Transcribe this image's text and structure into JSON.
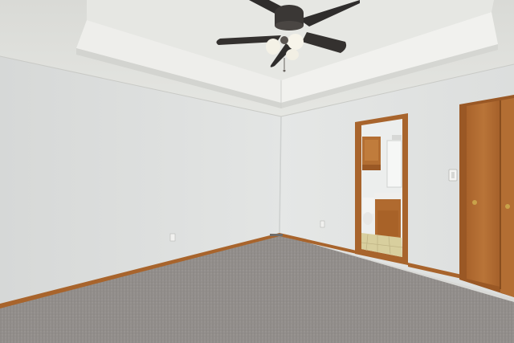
{
  "scene": {
    "description_items": [
      "ceiling-fan",
      "tray-ceiling",
      "bathroom-doorway",
      "closet-door",
      "carpet-floor",
      "wall-outlet",
      "light-switch"
    ]
  },
  "colors": {
    "ceiling": "#e2e3df",
    "tray_inner": "#e7e7e4",
    "left_wall": "#dcdedd",
    "back_wall": "#e4e6e5",
    "right_wall": "#e3e5e4",
    "carpet": "#8f8b88",
    "trim_wood": "#a8642c",
    "door_wood": "#b06a2f",
    "fan_dark": "#2f2d2c"
  }
}
